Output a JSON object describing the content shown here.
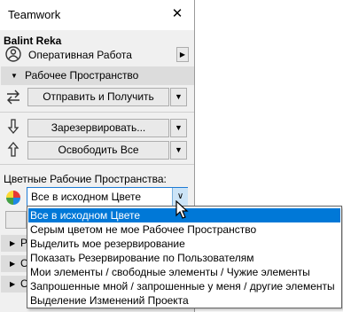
{
  "window": {
    "title": "Teamwork"
  },
  "user": {
    "name": "Balint Reka"
  },
  "mode_row": {
    "label": "Оперативная Работа"
  },
  "workspace_section": {
    "label": "Рабочее Пространство"
  },
  "buttons": {
    "send_receive": "Отправить и Получить",
    "reserve": "Зарезервировать...",
    "release_all": "Освободить Все"
  },
  "color_section": {
    "label": "Цветные Рабочие Пространства:",
    "selected": "Все в исходном Цвете"
  },
  "dropdown": {
    "options": [
      "Все в исходном Цвете",
      "Серым цветом не мое Рабочее Пространство",
      "Выделить мое резервирование",
      "Показать Резервирование по Пользователям",
      "Мои элементы / свободные элементы / Чужие элементы",
      "Запрошенные мной / запрошенные у меня / другие элементы",
      "Выделение Изменений Проекта"
    ],
    "selected_index": 0
  },
  "partial_rows": [
    "Р",
    "С",
    "С"
  ],
  "icons": {
    "close": "close-icon",
    "mode": "people-icon",
    "send_receive": "exchange-arrows-icon",
    "reserve": "down-arrow-icon",
    "color": "color-wheel-icon"
  }
}
